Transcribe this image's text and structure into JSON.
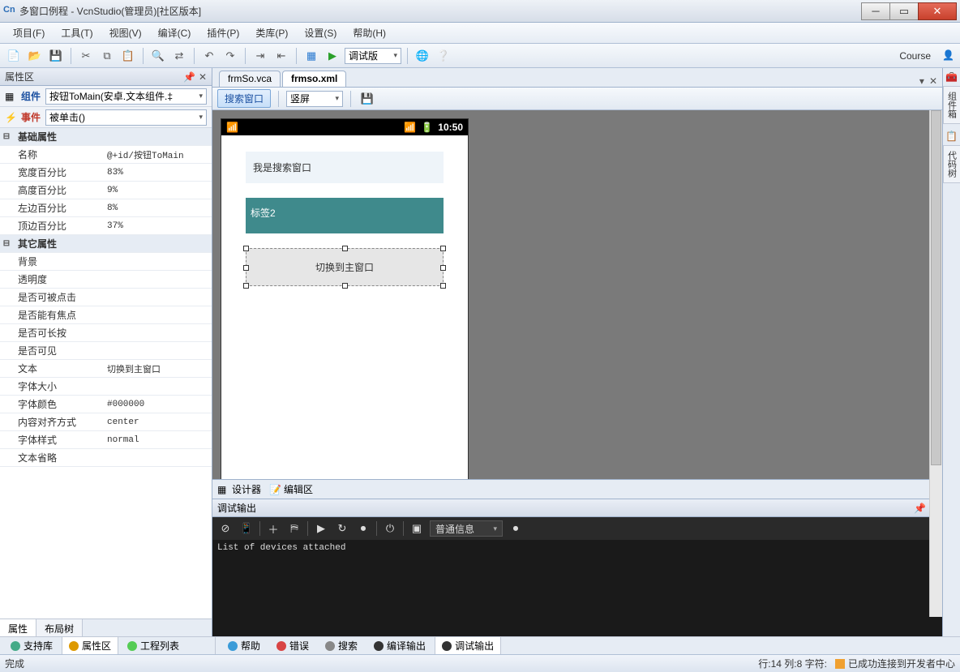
{
  "title": "多窗口例程 - VcnStudio(管理员)[社区版本]",
  "menu": [
    "项目(F)",
    "工具(T)",
    "视图(V)",
    "编译(C)",
    "插件(P)",
    "类库(P)",
    "设置(S)",
    "帮助(H)"
  ],
  "toolbar": {
    "build_mode": "调试版",
    "course": "Course"
  },
  "property_panel": {
    "title": "属性区",
    "component_label": "组件",
    "component_value": "按钮ToMain(安卓.文本组件.‡",
    "event_label": "事件",
    "event_value": "被单击()",
    "groups": [
      {
        "name": "基础属性",
        "rows": [
          {
            "n": "名称",
            "v": "@+id/按钮ToMain"
          },
          {
            "n": "宽度百分比",
            "v": "83%"
          },
          {
            "n": "高度百分比",
            "v": "9%"
          },
          {
            "n": "左边百分比",
            "v": "8%"
          },
          {
            "n": "顶边百分比",
            "v": "37%"
          }
        ]
      },
      {
        "name": "其它属性",
        "rows": [
          {
            "n": "背景",
            "v": ""
          },
          {
            "n": "透明度",
            "v": ""
          },
          {
            "n": "是否可被点击",
            "v": ""
          },
          {
            "n": "是否能有焦点",
            "v": ""
          },
          {
            "n": "是否可长按",
            "v": ""
          },
          {
            "n": "是否可见",
            "v": ""
          },
          {
            "n": "文本",
            "v": "切换到主窗口"
          },
          {
            "n": "字体大小",
            "v": ""
          },
          {
            "n": "字体颜色",
            "v": "#000000"
          },
          {
            "n": "内容对齐方式",
            "v": "center"
          },
          {
            "n": "字体样式",
            "v": "normal"
          },
          {
            "n": "文本省略",
            "v": ""
          }
        ]
      }
    ],
    "tabs": [
      "属性",
      "布局树"
    ]
  },
  "doc_tabs": {
    "inactive": "frmSo.vca",
    "active": "frmso.xml"
  },
  "design_bar": {
    "search": "搜索窗口",
    "orient": "竖屏"
  },
  "phone": {
    "time": "10:50",
    "input_text": "我是搜索窗口",
    "label2": "标签2",
    "button_text": "切换到主窗口"
  },
  "design_tabs": {
    "designer": "设计器",
    "editor": "编辑区"
  },
  "right_tabs": [
    "组件箱",
    "代码树"
  ],
  "debug": {
    "title": "调试输出",
    "filter": "普通信息",
    "console": "List of devices attached"
  },
  "left_bottom_tabs": [
    {
      "icon": "#4a8",
      "label": "支持库"
    },
    {
      "icon": "#d90",
      "label": "属性区",
      "active": true
    },
    {
      "icon": "#5c5",
      "label": "工程列表"
    }
  ],
  "bottom_tabs": [
    {
      "icon": "#3a9bd8",
      "label": "帮助"
    },
    {
      "icon": "#d84444",
      "label": "错误"
    },
    {
      "icon": "#888",
      "label": "搜索"
    },
    {
      "icon": "#333",
      "label": "编译输出"
    },
    {
      "icon": "#333",
      "label": "调试输出",
      "active": true
    }
  ],
  "status": {
    "left": "完成",
    "pos": "行:14 列:8 字符:",
    "connected": "已成功连接到开发者中心"
  }
}
